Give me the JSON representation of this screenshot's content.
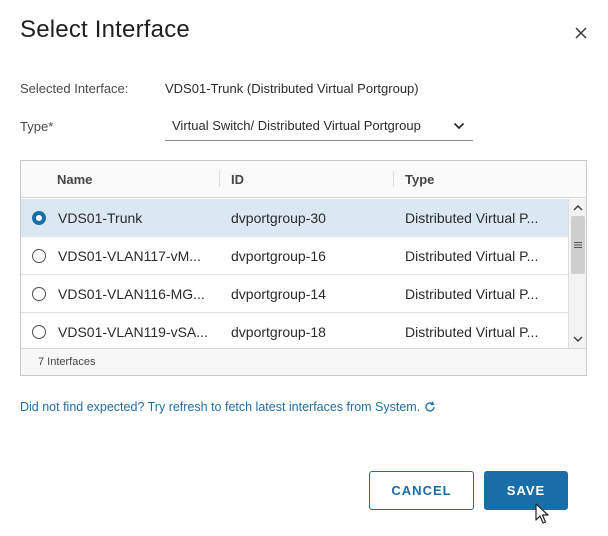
{
  "dialog": {
    "title": "Select Interface",
    "close_icon": "close-icon"
  },
  "selected_interface": {
    "label": "Selected Interface:",
    "value": "VDS01-Trunk (Distributed Virtual Portgroup)"
  },
  "type_field": {
    "label": "Type",
    "required_marker": "*",
    "value": "Virtual Switch/ Distributed Virtual Portgroup",
    "icon": "chevron-down-icon"
  },
  "grid": {
    "columns": [
      "Name",
      "ID",
      "Type"
    ],
    "rows": [
      {
        "name": "VDS01-Trunk",
        "id": "dvportgroup-30",
        "type": "Distributed Virtual P...",
        "selected": true
      },
      {
        "name": "VDS01-VLAN117-vM...",
        "id": "dvportgroup-16",
        "type": "Distributed Virtual P...",
        "selected": false
      },
      {
        "name": "VDS01-VLAN116-MG...",
        "id": "dvportgroup-14",
        "type": "Distributed Virtual P...",
        "selected": false
      },
      {
        "name": "VDS01-VLAN119-vSA...",
        "id": "dvportgroup-18",
        "type": "Distributed Virtual P...",
        "selected": false
      }
    ],
    "footer": "7 Interfaces"
  },
  "hint": {
    "text": "Did not find expected? Try refresh to fetch latest interfaces from System.",
    "icon": "refresh-icon"
  },
  "buttons": {
    "cancel": "CANCEL",
    "save": "SAVE"
  },
  "colors": {
    "accent": "#1a6ea8",
    "selected_row": "#dbe8f2",
    "link": "#1f6fa5"
  }
}
